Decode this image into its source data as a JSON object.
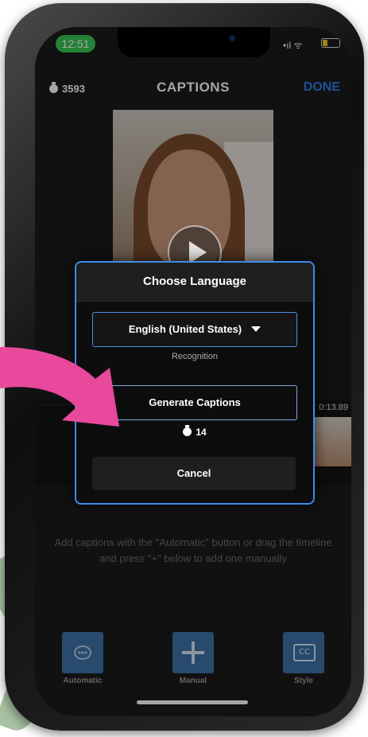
{
  "status_bar": {
    "time": "12:51",
    "signal": "•ıl ᯤ"
  },
  "header": {
    "credits": "3593",
    "title": "CAPTIONS",
    "done_label": "DONE"
  },
  "timeline": {
    "timecode": "0:13.89"
  },
  "dialog": {
    "title": "Choose Language",
    "language_selected": "English (United States)",
    "language_hint": "Recognition",
    "generate_label": "Generate Captions",
    "generate_cost": "14",
    "cancel_label": "Cancel"
  },
  "help_text": "Add captions with the \"Automatic\" button or drag the timeline and press \"+\" below to add one manually",
  "toolbar": {
    "automatic_label": "Automatic",
    "manual_label": "Manual",
    "style_label": "Style",
    "style_icon_text": "CC"
  },
  "colors": {
    "accent": "#2b7fe8",
    "dialog_border": "#3c8ee6",
    "arrow": "#e8499c",
    "status_green": "#38c653"
  }
}
